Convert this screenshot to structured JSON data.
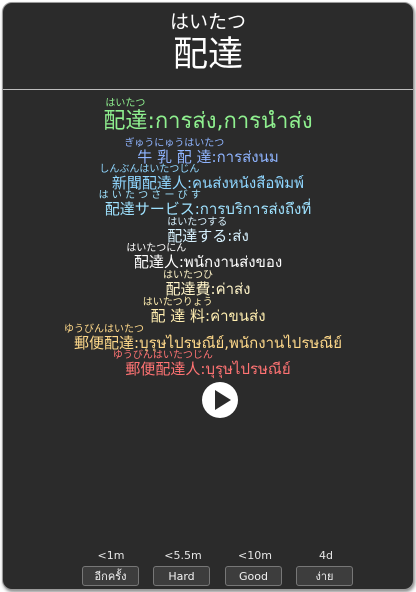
{
  "card": {
    "reading": "はいたつ",
    "word": "配達"
  },
  "examples": [
    {
      "furigana": "はいたつ",
      "word": "配達",
      "sep": " : ",
      "meaning": "การส่ง,การนำส่ง",
      "color": "#8ff08f"
    },
    {
      "furigana": "ぎゅうにゅうはいたつ",
      "word": "牛 乳 配 達",
      "sep": " : ",
      "meaning": "การส่งนม",
      "color": "#8fb4ff"
    },
    {
      "furigana": "しんぶんはいたつじん",
      "word": "新聞配達人",
      "sep": " : ",
      "meaning": "คนส่งหนังสือพิมพ์",
      "color": "#8fd6ff"
    },
    {
      "furigana": "は い た つ さ ー び す",
      "word": "配達サービス",
      "sep": " : ",
      "meaning": "การบริการส่งถึงที่",
      "color": "#9fe2ff"
    },
    {
      "furigana": "はいたつする",
      "word": "配達する",
      "sep": " : ",
      "meaning": "ส่ง",
      "color": "#d8f2ff"
    },
    {
      "furigana": "はいたつにん",
      "word": "配達人",
      "sep": " : ",
      "meaning": "พนักงานส่งของ",
      "color": "#ffffff"
    },
    {
      "furigana": "はいたつひ",
      "word": "配達費",
      "sep": " : ",
      "meaning": "ค่าส่ง",
      "color": "#fff4c8"
    },
    {
      "furigana": "はいたつりょう",
      "word": "配 達 料",
      "sep": " : ",
      "meaning": "ค่าขนส่ง",
      "color": "#ffeeb0"
    },
    {
      "furigana": "ゆうびんはいたつ",
      "word": "郵便配達",
      "sep": " : ",
      "meaning": "บุรุษไปรษณีย์,พนักงานไปรษณีย์",
      "color": "#ffd98a"
    },
    {
      "furigana": "ゆうびんはいたつじん",
      "word": "郵便配達人",
      "sep": " : ",
      "meaning": "บุรุษไปรษณีย์",
      "color": "#ff7373"
    }
  ],
  "answers": [
    {
      "time": "<1m",
      "label": "อีกครั้ง"
    },
    {
      "time": "<5.5m",
      "label": "Hard"
    },
    {
      "time": "<10m",
      "label": "Good"
    },
    {
      "time": "4d",
      "label": "ง่าย"
    }
  ]
}
